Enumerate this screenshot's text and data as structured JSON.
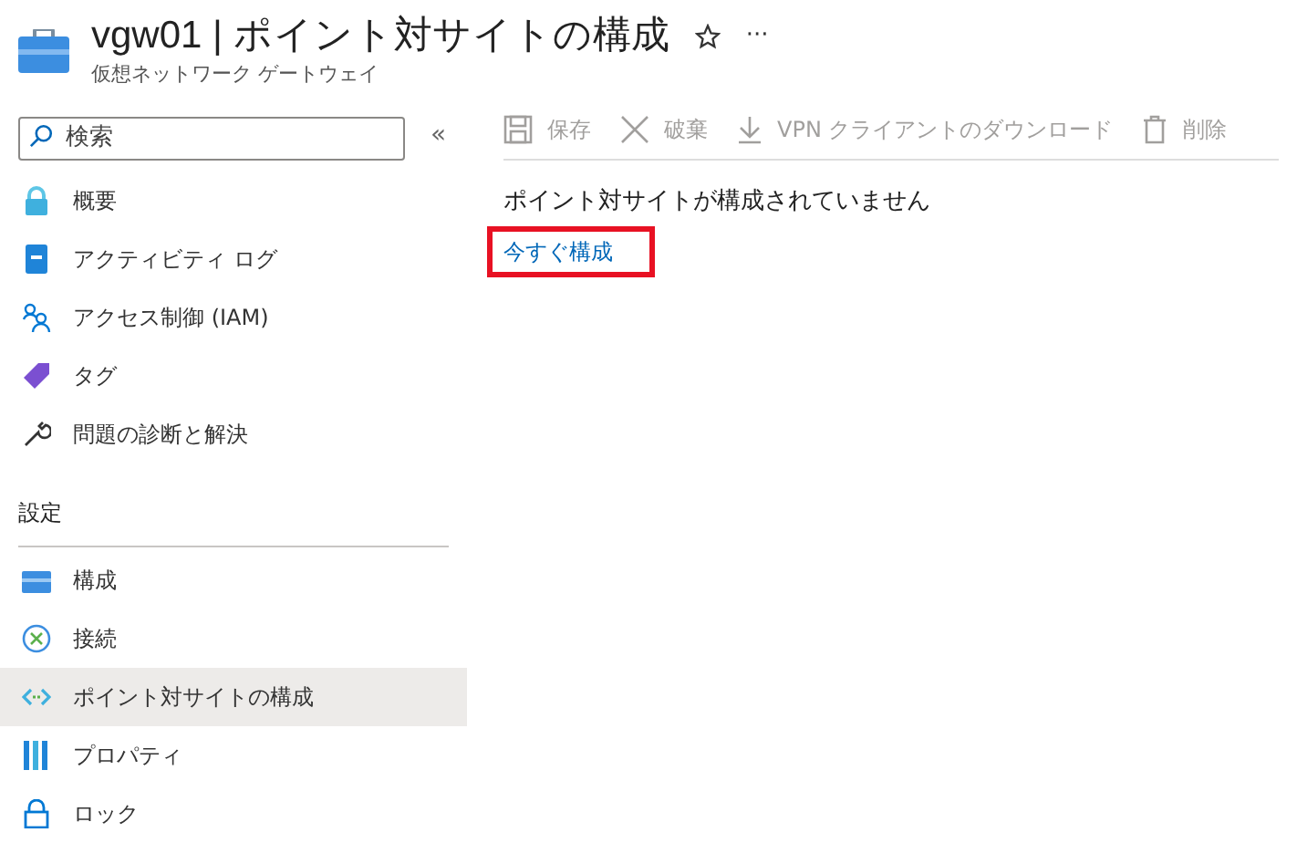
{
  "header": {
    "title": "vgw01 | ポイント対サイトの構成",
    "subtitle": "仮想ネットワーク ゲートウェイ",
    "more": "···"
  },
  "sidebar": {
    "search": {
      "placeholder": "検索"
    },
    "collapse": "«",
    "items": [
      {
        "label": "概要",
        "selected": false
      },
      {
        "label": "アクティビティ ログ",
        "selected": false
      },
      {
        "label": "アクセス制御 (IAM)",
        "selected": false
      },
      {
        "label": "タグ",
        "selected": false
      },
      {
        "label": "問題の診断と解決",
        "selected": false
      }
    ],
    "sections": [
      {
        "title": "設定",
        "items": [
          {
            "label": "構成",
            "selected": false
          },
          {
            "label": "接続",
            "selected": false
          },
          {
            "label": "ポイント対サイトの構成",
            "selected": true
          },
          {
            "label": "プロパティ",
            "selected": false
          },
          {
            "label": "ロック",
            "selected": false
          }
        ]
      }
    ]
  },
  "toolbar": [
    {
      "label": "保存",
      "disabled": true
    },
    {
      "label": "破棄",
      "disabled": true
    },
    {
      "label": "VPN クライアントのダウンロード",
      "disabled": true
    },
    {
      "label": "削除",
      "disabled": true
    }
  ],
  "content": {
    "message": "ポイント対サイトが構成されていません",
    "link": {
      "label": "今すぐ構成",
      "highlighted": true
    }
  }
}
